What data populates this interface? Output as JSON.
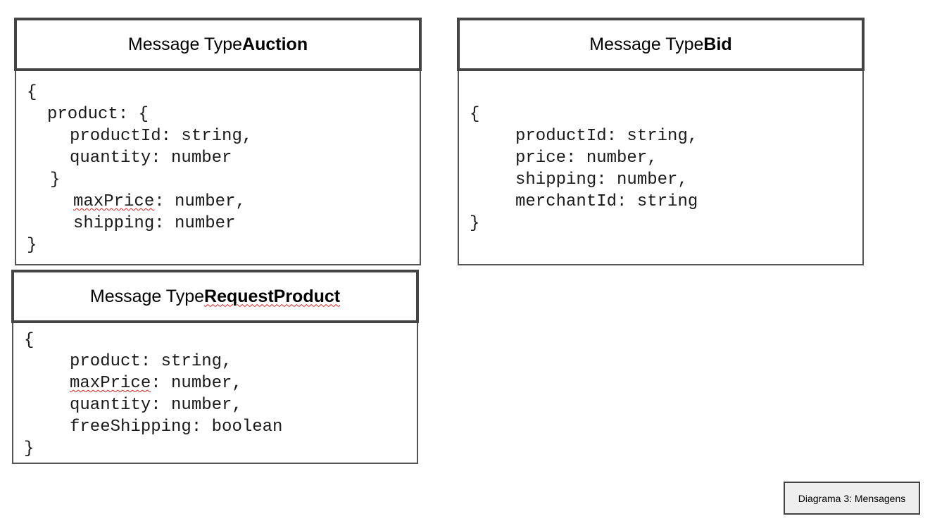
{
  "auction": {
    "header_prefix": "Message Type ",
    "header_name": "Auction",
    "code": {
      "open": "{",
      "product_open": "product: {",
      "product_id": "productId: string,",
      "quantity": "quantity: number",
      "product_close": "}",
      "max_price_key": "maxPrice",
      "max_price_rest": ": number,",
      "shipping": "shipping: number",
      "close": "}"
    }
  },
  "bid": {
    "header_prefix": "Message Type ",
    "header_name": "Bid",
    "code": {
      "open": "{",
      "product_id": "productId: string,",
      "price": "price: number,",
      "shipping": "shipping: number,",
      "merchant_id": "merchantId: string",
      "close": "}"
    }
  },
  "request_product": {
    "header_prefix": "Message Type ",
    "header_name": "RequestProduct",
    "code": {
      "open": "{",
      "product": "product: string,",
      "max_price_key": "maxPrice",
      "max_price_rest": ": number,",
      "quantity": "quantity: number,",
      "free_shipping": "freeShipping: boolean",
      "close": "}"
    }
  },
  "caption": "Diagrama 3: Mensagens",
  "colors": {
    "border": "#444444",
    "spellcheck_underline": "#e02020",
    "caption_background": "#eeeeee"
  }
}
